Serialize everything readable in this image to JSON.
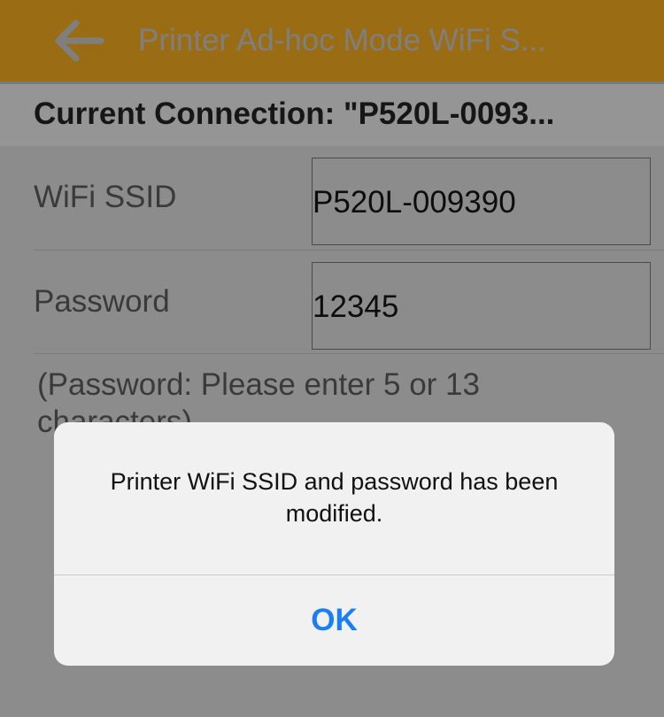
{
  "navbar": {
    "title": "Printer Ad-hoc Mode WiFi S...",
    "back_icon": "arrow-left-icon"
  },
  "current_connection": {
    "text": "Current Connection: \"P520L-0093..."
  },
  "form": {
    "ssid_label": "WiFi SSID",
    "ssid_value": "P520L-009390",
    "password_label": "Password",
    "password_value": "12345",
    "hint": "(Password: Please enter 5 or 13 characters)"
  },
  "dialog": {
    "message": "Printer WiFi SSID and password has been modified.",
    "ok_label": "OK"
  },
  "colors": {
    "navbar_bg": "#9a6d14",
    "dim_overlay_bg": "#8c8c8c",
    "dialog_bg": "#f1f1f1",
    "ok_blue": "#1a7ef5"
  }
}
